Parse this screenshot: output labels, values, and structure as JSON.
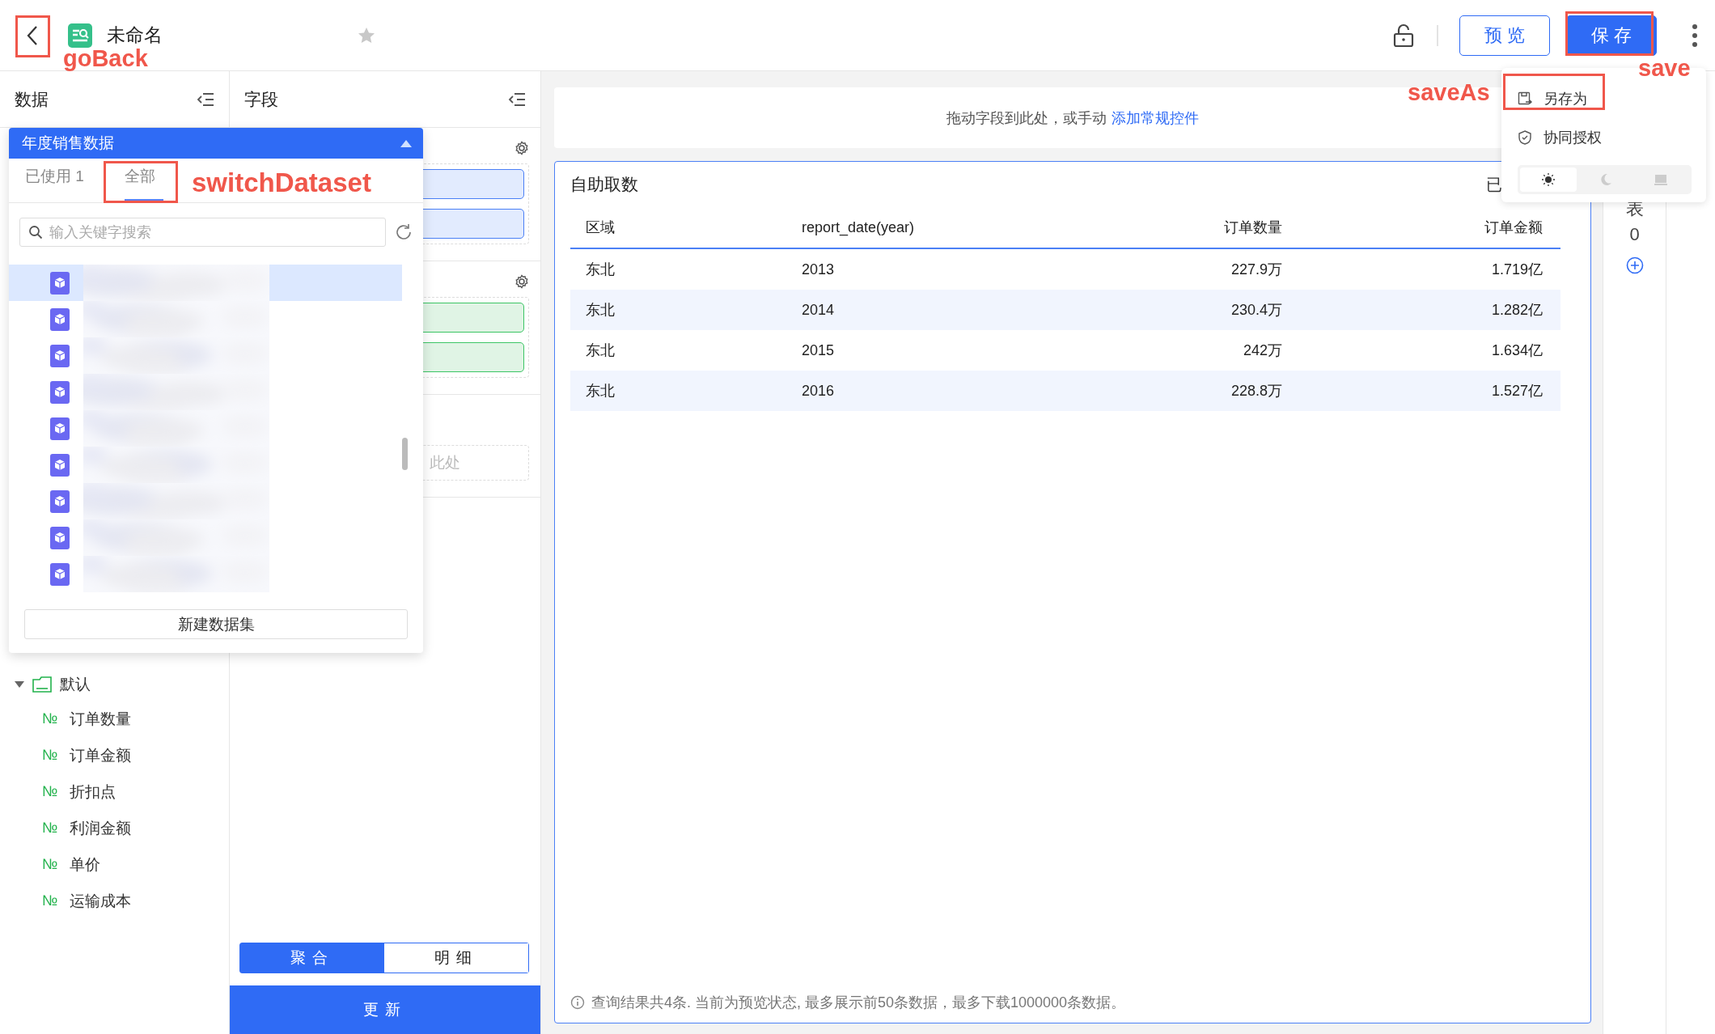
{
  "header": {
    "title": "未命名",
    "favorite": false,
    "buttons": [
      {
        "label": "预览",
        "kind": "outline"
      },
      {
        "label": "保存",
        "kind": "primary"
      }
    ]
  },
  "menu": {
    "items": [
      {
        "label": "另存为",
        "kind": "save-as"
      },
      {
        "label": "协同授权",
        "kind": "permission"
      }
    ],
    "theme": [
      {
        "kind": "light",
        "selected": true
      },
      {
        "kind": "dark",
        "selected": false
      },
      {
        "kind": "system",
        "selected": false
      }
    ]
  },
  "data_panel": {
    "title": "数据",
    "tree": [
      {
        "label": "默认",
        "expanded": true,
        "children": [
          {
            "type": "№",
            "label": "订单数量"
          },
          {
            "type": "№",
            "label": "订单金额"
          },
          {
            "type": "№",
            "label": "折扣点"
          },
          {
            "type": "№",
            "label": "利润金额"
          },
          {
            "type": "№",
            "label": "单价"
          },
          {
            "type": "№",
            "label": "运输成本"
          }
        ]
      }
    ]
  },
  "dataset_dropdown": {
    "title": "年度销售数据",
    "expanded": true,
    "tabs": [
      {
        "label": "已使用 1",
        "selected": false
      },
      {
        "label": "全部",
        "selected": true
      }
    ],
    "search": {
      "placeholder": "输入关键字搜索"
    },
    "datasets": [
      {
        "selected": true
      },
      {
        "selected": false
      },
      {
        "selected": false
      },
      {
        "selected": false
      },
      {
        "selected": false
      },
      {
        "selected": false
      },
      {
        "selected": false
      },
      {
        "selected": false
      },
      {
        "selected": false
      }
    ],
    "new_button": "新建数据集"
  },
  "field_panel": {
    "title": "字段",
    "sections": [
      {
        "kind": "dimension",
        "fields": [
          {
            "kind": "dimension"
          },
          {
            "kind": "dimension"
          }
        ]
      },
      {
        "kind": "measure",
        "fields": [
          {
            "kind": "measure"
          },
          {
            "kind": "measure"
          }
        ]
      },
      {
        "kind": "filter",
        "placeholder": "此处"
      }
    ],
    "mode_toggle": [
      {
        "label": "聚合",
        "selected": true
      },
      {
        "label": "明细",
        "selected": false
      }
    ],
    "update_button": "更新"
  },
  "control_bar": {
    "hint": "拖动字段到此处，或手动",
    "link": "添加常规控件"
  },
  "table_card": {
    "title": "自助取数",
    "selected_label": "已",
    "columns": [
      {
        "label": "区域",
        "kind": "dimension"
      },
      {
        "label": "report_date(year)",
        "kind": "dimension"
      },
      {
        "label": "订单数量",
        "kind": "measure"
      },
      {
        "label": "订单金额",
        "kind": "measure"
      }
    ],
    "rows": [
      [
        "东北",
        "2013",
        "227.9万",
        "1.719亿"
      ],
      [
        "东北",
        "2014",
        "230.4万",
        "1.282亿"
      ],
      [
        "东北",
        "2015",
        "242万",
        "1.634亿"
      ],
      [
        "东北",
        "2016",
        "228.8万",
        "1.527亿"
      ]
    ],
    "footer": "查询结果共4条. 当前为预览状态, 最多展示前50条数据，最多下载1000000条数据。"
  },
  "side_column": {
    "label": "表",
    "count": "0"
  },
  "annotations": [
    {
      "label": "goBack"
    },
    {
      "label": "switchDataset"
    },
    {
      "label": "saveAs"
    },
    {
      "label": "save"
    }
  ]
}
